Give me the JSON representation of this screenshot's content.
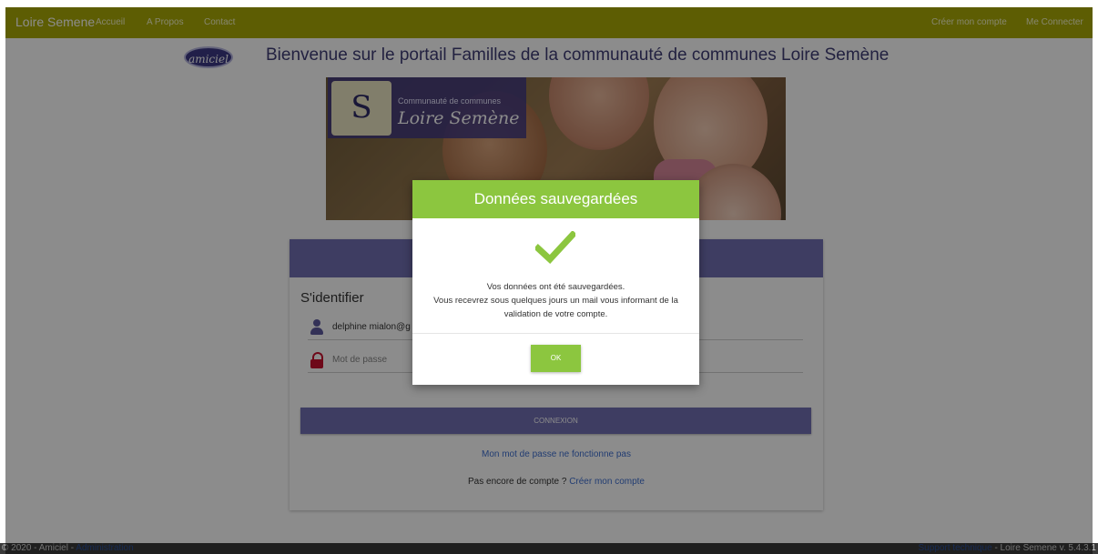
{
  "navbar": {
    "brand": "Loire Semene",
    "links": [
      "Accueil",
      "A Propos",
      "Contact"
    ],
    "right_links": [
      "Créer mon compte",
      "Me Connecter"
    ],
    "color": "#aaaa06"
  },
  "header": {
    "logo_text": "amiciel",
    "title": "Bienvenue sur le portail Familles de la communauté de communes Loire Semène"
  },
  "banner": {
    "subtitle": "Communauté de communes",
    "name": "Loire Semène"
  },
  "login": {
    "title": "S'identifier",
    "username_value": "delphine mialon@g",
    "password_placeholder": "Mot de passe",
    "submit_label": "CONNEXION",
    "forgot_link": "Mon mot de passe ne fonctionne pas",
    "signup_prefix": "Pas encore de compte ? ",
    "signup_link": "Créer mon compte",
    "accent_color": "#716fb2"
  },
  "modal": {
    "title": "Données sauvegardées",
    "message_line1": "Vos données ont été sauvegardées.",
    "message_line2": "Vous recevrez sous quelques jours un mail vous informant de la validation de votre compte.",
    "ok_label": "OK",
    "accent_color": "#8cc63f",
    "icon": "checkmark-icon"
  },
  "footer": {
    "left_text": "© 2020 - Amiciel - ",
    "left_link": "Administration",
    "right_link": "Support technique",
    "right_text": " - Loire Semene v. 5.4.3.1"
  }
}
